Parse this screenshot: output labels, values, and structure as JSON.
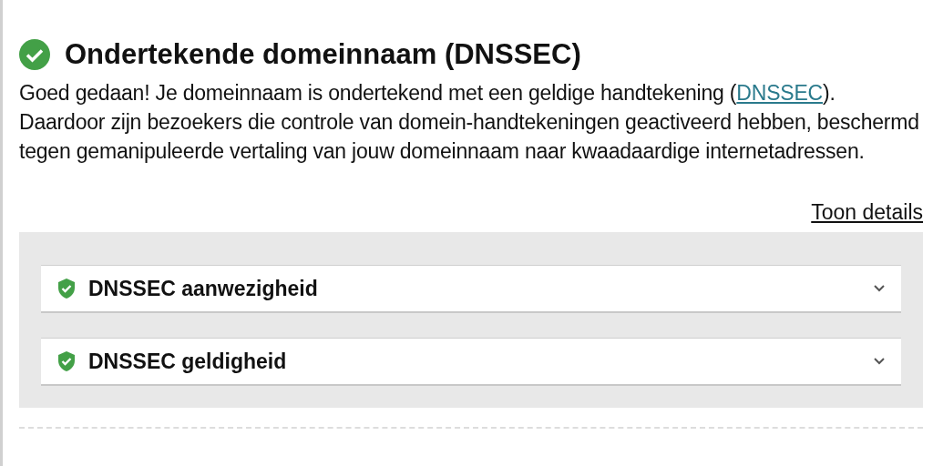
{
  "section": {
    "passed": true,
    "title": "Ondertekende domeinnaam (DNSSEC)",
    "text_before": "Goed gedaan! Je domeinnaam is ondertekend met een geldige handtekening (",
    "link": "DNSSEC",
    "text_after": "). Daardoor zijn bezoekers die controle van domein-handtekeningen geactiveerd hebben, beschermd tegen gemanipuleerde vertaling van jouw domeinnaam naar kwaadaardige internetadressen.",
    "details_link": "Toon details"
  },
  "checks": [
    {
      "label": "DNSSEC aanwezigheid",
      "passed": true,
      "expanded": false
    },
    {
      "label": "DNSSEC geldigheid",
      "passed": true,
      "expanded": false
    }
  ]
}
